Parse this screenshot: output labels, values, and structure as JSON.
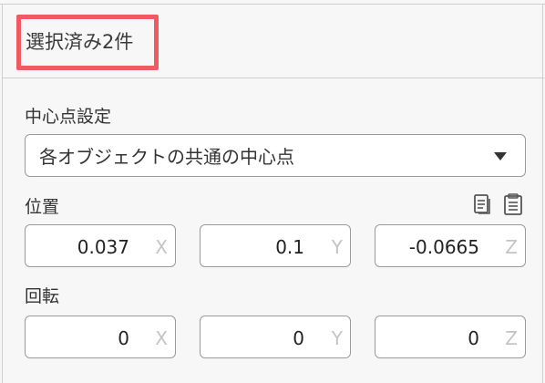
{
  "selection": {
    "label": "選択済み2件"
  },
  "pivot": {
    "label": "中心点設定",
    "selected": "各オブジェクトの共通の中心点"
  },
  "position": {
    "label": "位置",
    "icons": [
      "copy-icon",
      "paste-icon"
    ],
    "x": "0.037",
    "y": "0.1",
    "z": "-0.0665"
  },
  "rotation": {
    "label": "回転",
    "x": "0",
    "y": "0",
    "z": "0"
  },
  "axes": {
    "x": "X",
    "y": "Y",
    "z": "Z"
  },
  "colors": {
    "highlight": "#ef5a63",
    "panel": "#f7f7f7",
    "axis_label": "#c4c4c4"
  }
}
